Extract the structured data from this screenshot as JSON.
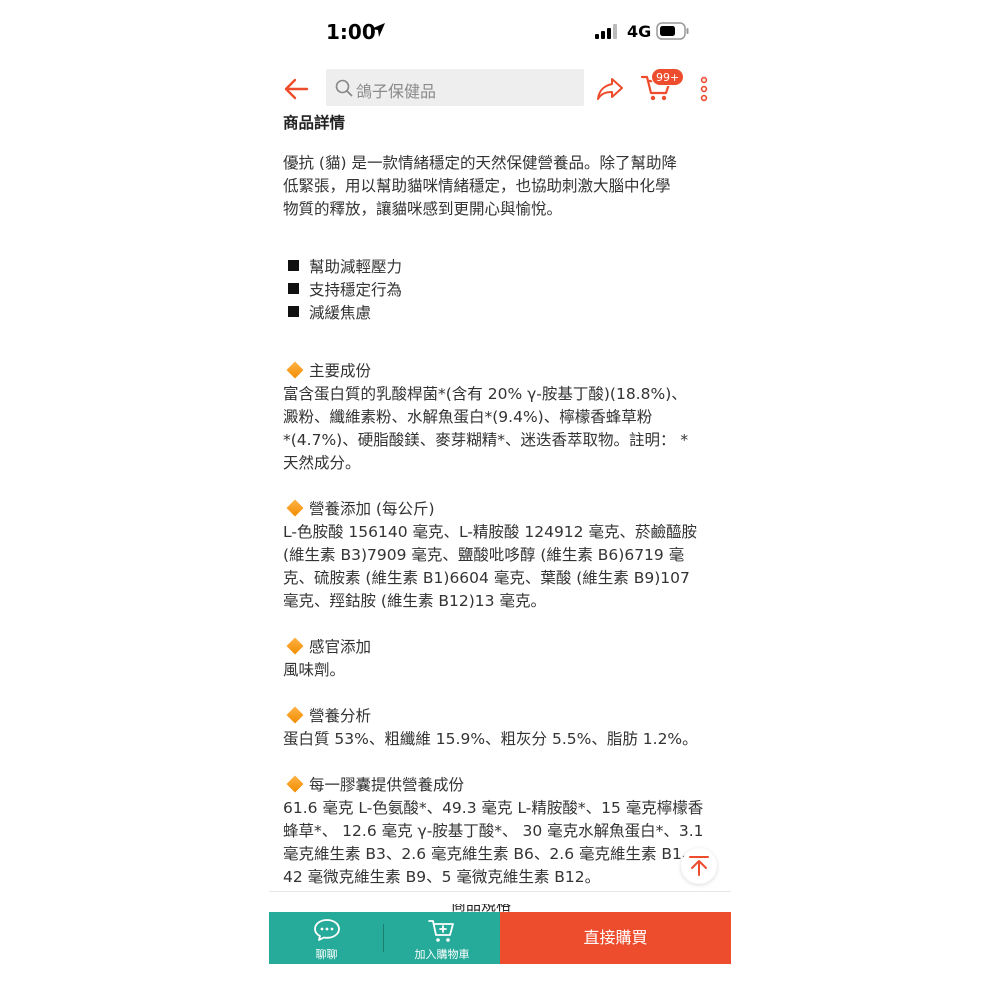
{
  "status_bar": {
    "time": "1:00",
    "network": "4G"
  },
  "header": {
    "search_placeholder": "鴿子保健品",
    "cart_badge": "99+"
  },
  "content": {
    "section_title": "商品詳情",
    "intro": [
      "優抗 (貓) 是一款情緒穩定的天然保健營養品。除了幫助降",
      "低緊張，用以幫助貓咪情緒穩定，也協助刺激大腦中化學",
      "物質的釋放，讓貓咪感到更開心與愉悅。"
    ],
    "bullets": [
      "幫助減輕壓力",
      "支持穩定行為",
      "減緩焦慮"
    ],
    "sections": [
      {
        "heading": "主要成份",
        "lines": [
          "富含蛋白質的乳酸桿菌*(含有 20% γ-胺基丁酸)(18.8%)、",
          "澱粉、纖維素粉、水解魚蛋白*(9.4%)、檸檬香蜂草粉",
          "*(4.7%)、硬脂酸鎂、麥芽糊精*、迷迭香萃取物。註明： *",
          "天然成分。"
        ]
      },
      {
        "heading": "營養添加 (每公斤)",
        "lines": [
          "L-色胺酸 156140 毫克、L-精胺酸 124912 毫克、菸鹼醯胺",
          " (維生素 B3)7909 毫克、鹽酸吡哆醇 (維生素 B6)6719 毫",
          "克、硫胺素 (維生素 B1)6604 毫克、葉酸 (維生素 B9)107",
          "毫克、羥鈷胺 (維生素 B12)13 毫克。"
        ]
      },
      {
        "heading": "感官添加",
        "lines": [
          "風味劑。"
        ]
      },
      {
        "heading": "營養分析",
        "lines": [
          "蛋白質 53%、粗纖維 15.9%、粗灰分 5.5%、脂肪 1.2%。"
        ]
      },
      {
        "heading": "每一膠囊提供營養成份",
        "lines": [
          "61.6 毫克 L-色氨酸*、49.3 毫克 L-精胺酸*、15 毫克檸檬香",
          "蜂草*、  12.6 毫克 γ-胺基丁酸*、  30 毫克水解魚蛋白*、3.1",
          "毫克維生素 B3、2.6 毫克維生素 B6、2.6 毫克維生素 B1、",
          "42 毫微克維生素 B9、5 毫微克維生素 B12。"
        ]
      }
    ],
    "partial_text": "商品規格"
  },
  "bottom_bar": {
    "chat_label": "聊聊",
    "cart_label": "加入購物車",
    "buy_label": "直接購買"
  },
  "colors": {
    "brand": "#ee4d2d",
    "teal": "#26aa99"
  }
}
